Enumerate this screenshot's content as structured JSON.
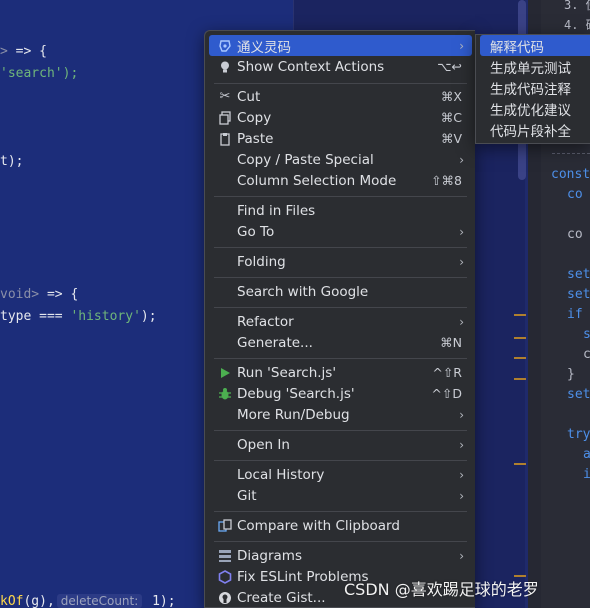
{
  "editor_left": {
    "line1_a": ">",
    "line1_b": " => {",
    "line2": "'search');",
    "line3": "t);",
    "line4_a": "void>",
    "line4_b": " => {",
    "line5_a": "type === ",
    "line5_b": "'history'",
    "line5_c": ");",
    "line6_a": "kOf",
    "line6_b": "(g),",
    "line6_hint": "deleteCount:",
    "line6_c": " 1);"
  },
  "editor_right": {
    "top1": "3. 使",
    "top2": "4. 确",
    "lines": [
      "const",
      "co",
      "co",
      "set",
      "set",
      "if",
      "s",
      "c",
      "}",
      "set",
      "try",
      "a",
      "i"
    ]
  },
  "context_menu": {
    "items": [
      {
        "label": "通义灵码",
        "shortcut": "",
        "submenu": true,
        "icon": "tongyi-icon"
      },
      {
        "label": "Show Context Actions",
        "shortcut": "⌥↩",
        "submenu": false,
        "icon": "lightbulb-icon"
      },
      {
        "label": "Cut",
        "shortcut": "⌘X",
        "submenu": false,
        "icon": "scissors-icon"
      },
      {
        "label": "Copy",
        "shortcut": "⌘C",
        "submenu": false,
        "icon": "copy-icon"
      },
      {
        "label": "Paste",
        "shortcut": "⌘V",
        "submenu": false,
        "icon": "clipboard-icon"
      },
      {
        "label": "Copy / Paste Special",
        "shortcut": "",
        "submenu": true,
        "icon": ""
      },
      {
        "label": "Column Selection Mode",
        "shortcut": "⇧⌘8",
        "submenu": false,
        "icon": ""
      },
      {
        "label": "Find in Files",
        "shortcut": "",
        "submenu": false,
        "icon": ""
      },
      {
        "label": "Go To",
        "shortcut": "",
        "submenu": true,
        "icon": ""
      },
      {
        "label": "Folding",
        "shortcut": "",
        "submenu": true,
        "icon": ""
      },
      {
        "label": "Search with Google",
        "shortcut": "",
        "submenu": false,
        "icon": ""
      },
      {
        "label": "Refactor",
        "shortcut": "",
        "submenu": true,
        "icon": ""
      },
      {
        "label": "Generate...",
        "shortcut": "⌘N",
        "submenu": false,
        "icon": ""
      },
      {
        "label": "Run 'Search.js'",
        "shortcut": "^⇧R",
        "submenu": false,
        "icon": "run-icon"
      },
      {
        "label": "Debug 'Search.js'",
        "shortcut": "^⇧D",
        "submenu": false,
        "icon": "debug-icon"
      },
      {
        "label": "More Run/Debug",
        "shortcut": "",
        "submenu": true,
        "icon": ""
      },
      {
        "label": "Open In",
        "shortcut": "",
        "submenu": true,
        "icon": ""
      },
      {
        "label": "Local History",
        "shortcut": "",
        "submenu": true,
        "icon": ""
      },
      {
        "label": "Git",
        "shortcut": "",
        "submenu": true,
        "icon": ""
      },
      {
        "label": "Compare with Clipboard",
        "shortcut": "",
        "submenu": false,
        "icon": "compare-icon"
      },
      {
        "label": "Diagrams",
        "shortcut": "",
        "submenu": true,
        "icon": "diagram-icon"
      },
      {
        "label": "Fix ESLint Problems",
        "shortcut": "",
        "submenu": false,
        "icon": "eslint-icon"
      },
      {
        "label": "Create Gist...",
        "shortcut": "",
        "submenu": false,
        "icon": "github-icon"
      }
    ]
  },
  "submenu": {
    "items": [
      "解释代码",
      "生成单元测试",
      "生成代码注释",
      "生成优化建议",
      "代码片段补全"
    ]
  },
  "watermark": "CSDN @喜欢踢足球的老罗",
  "colors": {
    "menu_bg": "#2b2d31",
    "highlight": "#2f5bcd",
    "editor_bg": "#1c2d7a"
  }
}
